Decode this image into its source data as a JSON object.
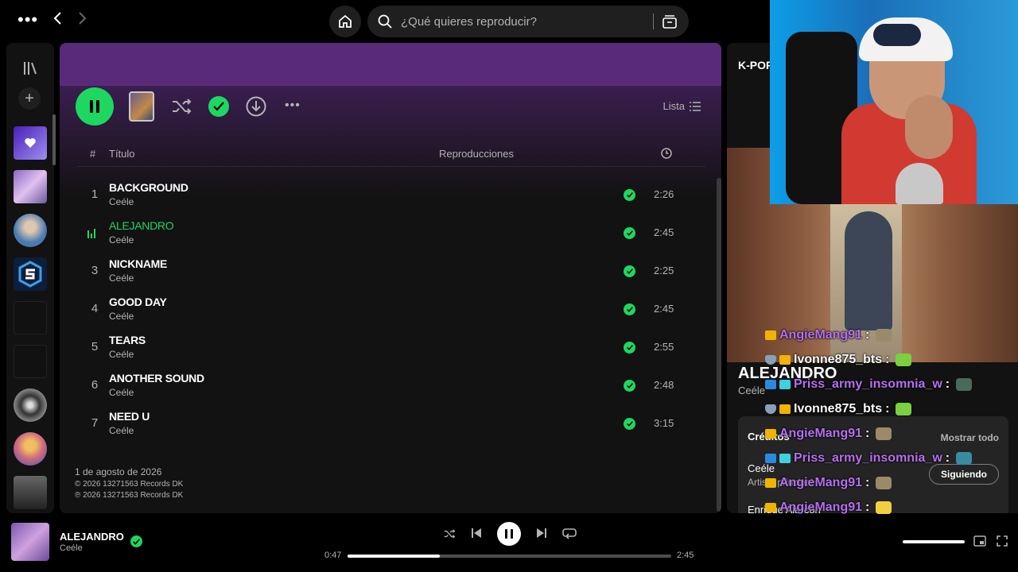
{
  "topbar": {
    "search_placeholder": "¿Qué quieres reproducir?"
  },
  "main": {
    "list_view_label": "Lista",
    "table_headers": {
      "number": "#",
      "title": "Título",
      "plays": "Reproducciones"
    },
    "tracks": [
      {
        "number": "1",
        "title": "BACKGROUND",
        "artist": "Ceéle",
        "duration": "2:26",
        "playing": false
      },
      {
        "number": "2",
        "title": "ALEJANDRO",
        "artist": "Ceéle",
        "duration": "2:45",
        "playing": true
      },
      {
        "number": "3",
        "title": "NICKNAME",
        "artist": "Ceéle",
        "duration": "2:25",
        "playing": false
      },
      {
        "number": "4",
        "title": "GOOD DAY",
        "artist": "Ceéle",
        "duration": "2:45",
        "playing": false
      },
      {
        "number": "5",
        "title": "TEARS",
        "artist": "Ceéle",
        "duration": "2:55",
        "playing": false
      },
      {
        "number": "6",
        "title": "ANOTHER SOUND",
        "artist": "Ceéle",
        "duration": "2:48",
        "playing": false
      },
      {
        "number": "7",
        "title": "NEED U",
        "artist": "Ceéle",
        "duration": "3:15",
        "playing": false
      }
    ],
    "release_date": "1 de agosto de 2026",
    "copyright_c": "© 2026 13271563 Records DK",
    "copyright_p": "℗ 2026 13271563 Records DK"
  },
  "now_playing_panel": {
    "playlist_label": "K-POP",
    "title": "ALEJANDRO",
    "artist": "Ceéle",
    "credits_title": "Créditos",
    "show_all": "Mostrar todo",
    "credit_name": "Ceéle",
    "credit_role": "Artista principal",
    "follow_button": "Siguiendo",
    "credit_name_2": "Enrique Alarcón"
  },
  "chat": {
    "messages": [
      {
        "user": "AngieMang91",
        "color": "#b470f0",
        "badges": [
          "crown"
        ]
      },
      {
        "user": "Ivonne875_bts",
        "color": "#ffffff",
        "badges": [
          "shield",
          "crown"
        ]
      },
      {
        "user": "Priss_army_insomnia_w",
        "color": "#b470f0",
        "badges": [
          "prime",
          "gift"
        ]
      },
      {
        "user": "Ivonne875_bts",
        "color": "#ffffff",
        "badges": [
          "shield",
          "crown"
        ]
      },
      {
        "user": "AngieMang91",
        "color": "#b470f0",
        "badges": [
          "crown"
        ]
      },
      {
        "user": "Priss_army_insomnia_w",
        "color": "#b470f0",
        "badges": [
          "prime",
          "gift"
        ]
      },
      {
        "user": "AngieMang91",
        "color": "#b470f0",
        "badges": [
          "crown"
        ]
      },
      {
        "user": "AngieMang91",
        "color": "#b470f0",
        "badges": [
          "crown"
        ]
      },
      {
        "user": "AngieMang91",
        "color": "#b470f0",
        "badges": [
          "crown"
        ]
      },
      {
        "user": "AngieMang91",
        "color": "#b470f0",
        "badges": [
          "crown"
        ]
      }
    ]
  },
  "player": {
    "title": "ALEJANDRO",
    "artist": "Ceéle",
    "elapsed": "0:47",
    "total": "2:45",
    "progress_fraction": 0.285
  },
  "colors": {
    "accent": "#1ed760",
    "header_purple": "#5a2a7a",
    "chat_purple": "#b470f0"
  },
  "icons": [
    "more-icon",
    "back-icon",
    "forward-icon",
    "home-icon",
    "search-icon",
    "browse-icon",
    "library-icon",
    "shuffle-icon",
    "check-icon",
    "download-icon",
    "clock-icon",
    "list-icon",
    "previous-icon",
    "next-icon",
    "repeat-icon",
    "pause-icon"
  ]
}
